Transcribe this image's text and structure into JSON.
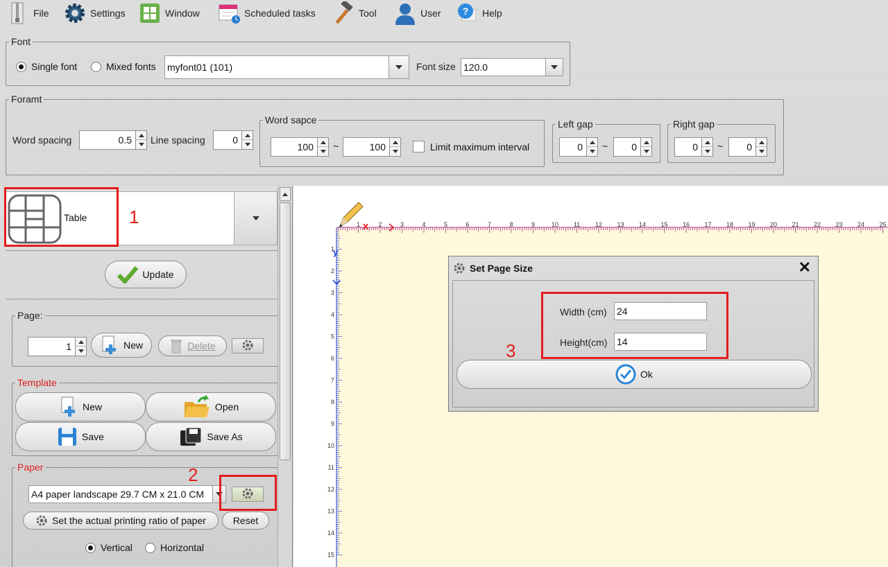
{
  "menu": {
    "file": "File",
    "settings": "Settings",
    "window": "Window",
    "scheduled": "Scheduled tasks",
    "tool": "Tool",
    "user": "User",
    "help": "Help"
  },
  "font_group": {
    "legend": "Font",
    "single": "Single font",
    "mixed": "Mixed fonts",
    "font_value": "myfont01 (101)",
    "size_label": "Font size",
    "size_value": "120.0"
  },
  "format_group": {
    "legend": "Foramt",
    "word_spacing_label": "Word spacing",
    "word_spacing": "0.5",
    "line_spacing_label": "Line spacing",
    "line_spacing": "0",
    "word_space_legend": "Word sapce",
    "ws_min": "100",
    "ws_max": "100",
    "tilde": "~",
    "limit_label": "Limit maximum interval",
    "left_gap_legend": "Left gap",
    "lg_min": "0",
    "lg_max": "0",
    "right_gap_legend": "Right gap",
    "rg_min": "0",
    "rg_max": "0"
  },
  "left_panel": {
    "table_label": "Table",
    "update": "Update",
    "page_legend": "Page:",
    "page_value": "1",
    "page_new": "New",
    "page_delete": "Delete",
    "template_legend": "Template",
    "tpl_new": "New",
    "tpl_open": "Open",
    "tpl_save": "Save",
    "tpl_saveas": "Save As",
    "paper_legend": "Paper",
    "paper_value": "A4 paper landscape 29.7 CM x 21.0 CM",
    "ratio": "Set the actual printing ratio of paper",
    "reset": "Reset",
    "vertical": "Vertical",
    "horizontal": "Horizontal"
  },
  "annotations": {
    "a1": "1",
    "a2": "2",
    "a3": "3"
  },
  "ruler": {
    "top": [
      "1",
      "2",
      "3",
      "4",
      "5",
      "6",
      "7",
      "8",
      "9",
      "10",
      "11",
      "12",
      "13",
      "14",
      "15",
      "16",
      "17",
      "18",
      "19",
      "20",
      "21",
      "22",
      "23",
      "24",
      "25"
    ],
    "left": [
      "1",
      "2",
      "3",
      "4",
      "5",
      "6",
      "7",
      "8",
      "9",
      "10",
      "11",
      "12",
      "13",
      "14",
      "15"
    ],
    "x_mark": "x",
    "y_mark": "y"
  },
  "dialog": {
    "title": "Set Page Size",
    "width_label": "Width (cm)",
    "width_value": "24",
    "height_label": "Height(cm)",
    "height_value": "14",
    "ok": "Ok"
  },
  "colors": {
    "annotation_red": "#e51b1b",
    "paper": "#fff8dc",
    "ruler_magenta": "#b0307a",
    "ruler_blue": "#1a3fd6"
  }
}
